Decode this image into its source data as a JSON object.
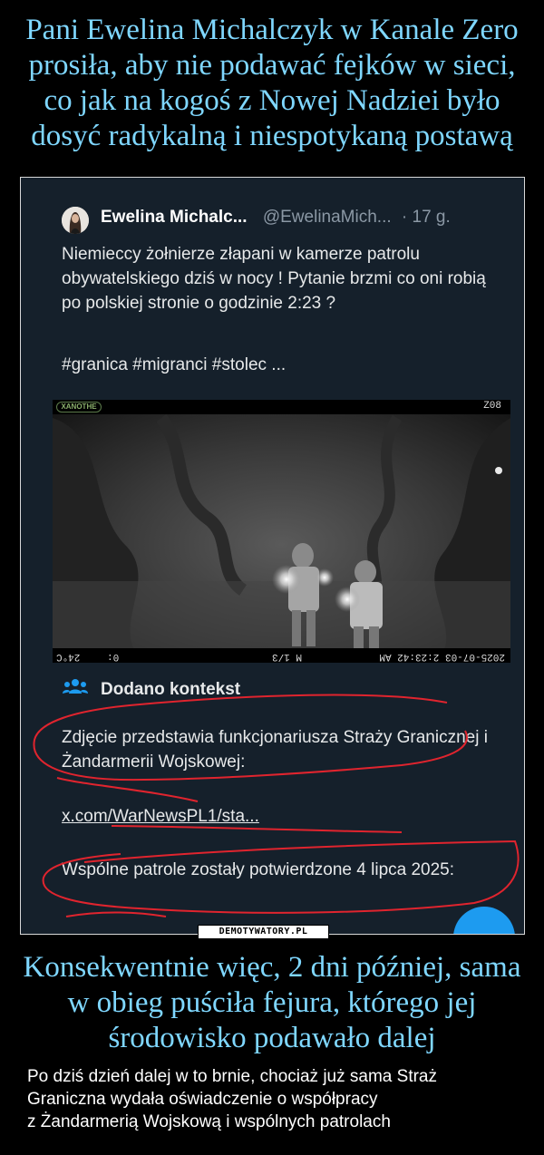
{
  "top_title": "Pani Ewelina Michalczyk w Kanale Zero prosiła, aby nie podawać fejków w sieci, co jak na kogoś z Nowej Nadziei było dosyć radykalną i niespotykaną postawą",
  "tweet": {
    "author_name": "Ewelina Michalc...",
    "author_handle": "@EwelinaMich...",
    "time": "· 17 g.",
    "text": "Niemieccy żołnierze złapani w kamerze patrolu obywatelskiego dziś w nocy ! Pytanie brzmi co oni robią po polskiej stronie o godzinie 2:23 ?",
    "hashtags": "#granica #migranci #stolec ...",
    "camera": {
      "brand": "XANOTHE",
      "id": "Z08",
      "bottom_left": "24°C",
      "bottom_mid": "0:",
      "moon": "M 1/3",
      "timestamp": "2025-07-03 2:23:42 AM"
    }
  },
  "context": {
    "title": "Dodano kontekst",
    "body": "Zdjęcie przedstawia funkcjonariusza Straży Granicznej i Żandarmerii Wojskowej:",
    "link": "x.com/WarNewsPL1/sta...",
    "confirm": "Wspólne patrole zostały potwierdzone 4 lipca 2025:"
  },
  "watermark": "DEMOTYWATORY.PL",
  "bottom_title": "Konsekwentnie więc, 2 dni później, sama w obieg puściła fejura, którego jej środowisko podawało dalej",
  "caption": {
    "line1": "Po dziś dzień dalej w to brnie, chociaż już sama Straż",
    "line2": "Graniczna wydała oświadczenie o współpracy",
    "line3": "z Żandarmerią Wojskową i wspólnych patrolach"
  },
  "colors": {
    "title_color": "#7fd7ff",
    "tweet_bg": "#15202b",
    "annotation_red": "#e0242e",
    "link_blue": "#1d9bf0"
  }
}
